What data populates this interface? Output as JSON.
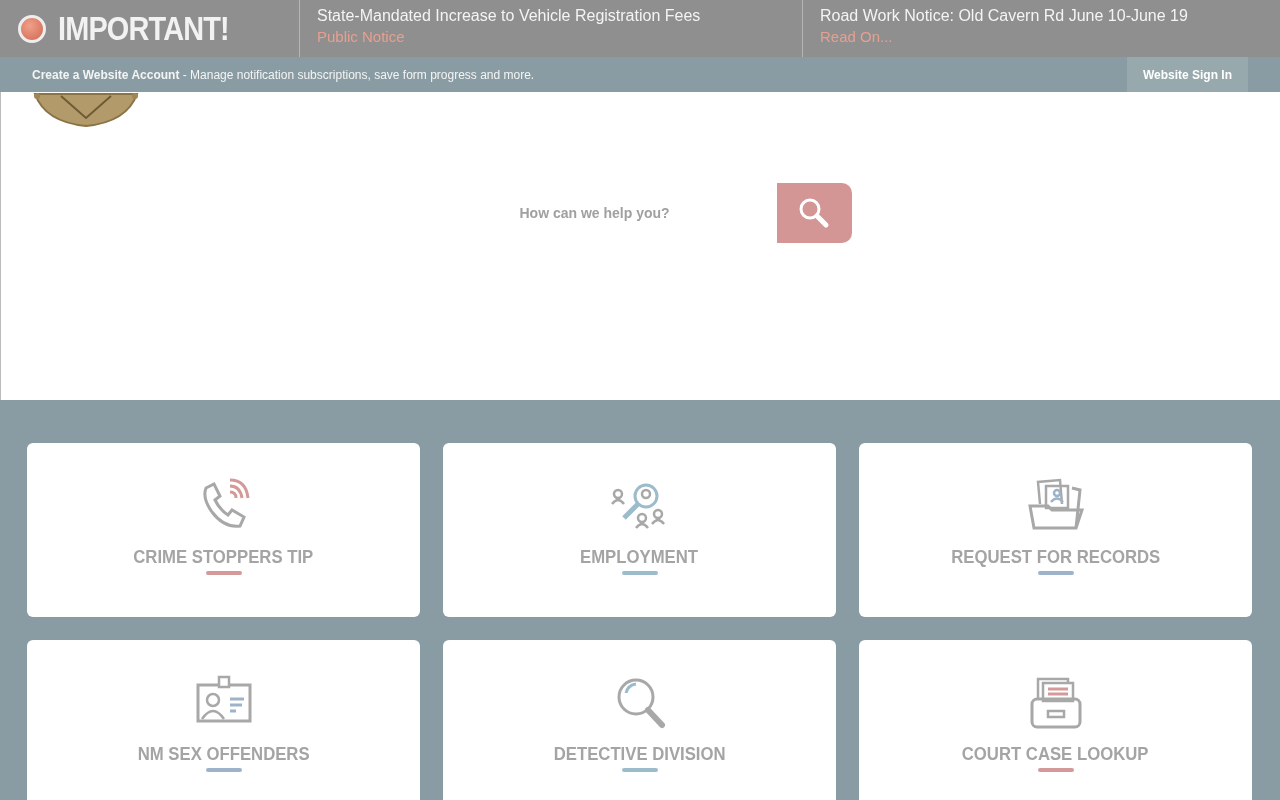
{
  "alert_bar": {
    "label": "IMPORTANT!",
    "notices": [
      {
        "title": "State-Mandated Increase to Vehicle Registration Fees",
        "link": "Public Notice"
      },
      {
        "title": "Road Work Notice: Old Cavern Rd June 10-June 19",
        "link": "Read On..."
      }
    ]
  },
  "account_bar": {
    "message": "**Create a Website Account** - Manage notification subscriptions, save form progress and more.",
    "sign_in": "Website Sign In"
  },
  "search": {
    "placeholder": "How can we help you?"
  },
  "tiles": [
    {
      "label": "CRIME STOPPERS TIP",
      "kind": "phone",
      "color": "#d49a9a"
    },
    {
      "label": "EMPLOYMENT",
      "kind": "people",
      "color": "#9dbccb"
    },
    {
      "label": "REQUEST FOR RECORDS",
      "kind": "folder",
      "color": "#9db3c9"
    },
    {
      "label": "NM SEX OFFENDERS",
      "kind": "idcard",
      "color": "#9db3c9"
    },
    {
      "label": "DETECTIVE DIVISION",
      "kind": "magnifier",
      "color": "#9dbccb"
    },
    {
      "label": "COURT CASE LOOKUP",
      "kind": "tray",
      "color": "#d49a9a"
    }
  ]
}
